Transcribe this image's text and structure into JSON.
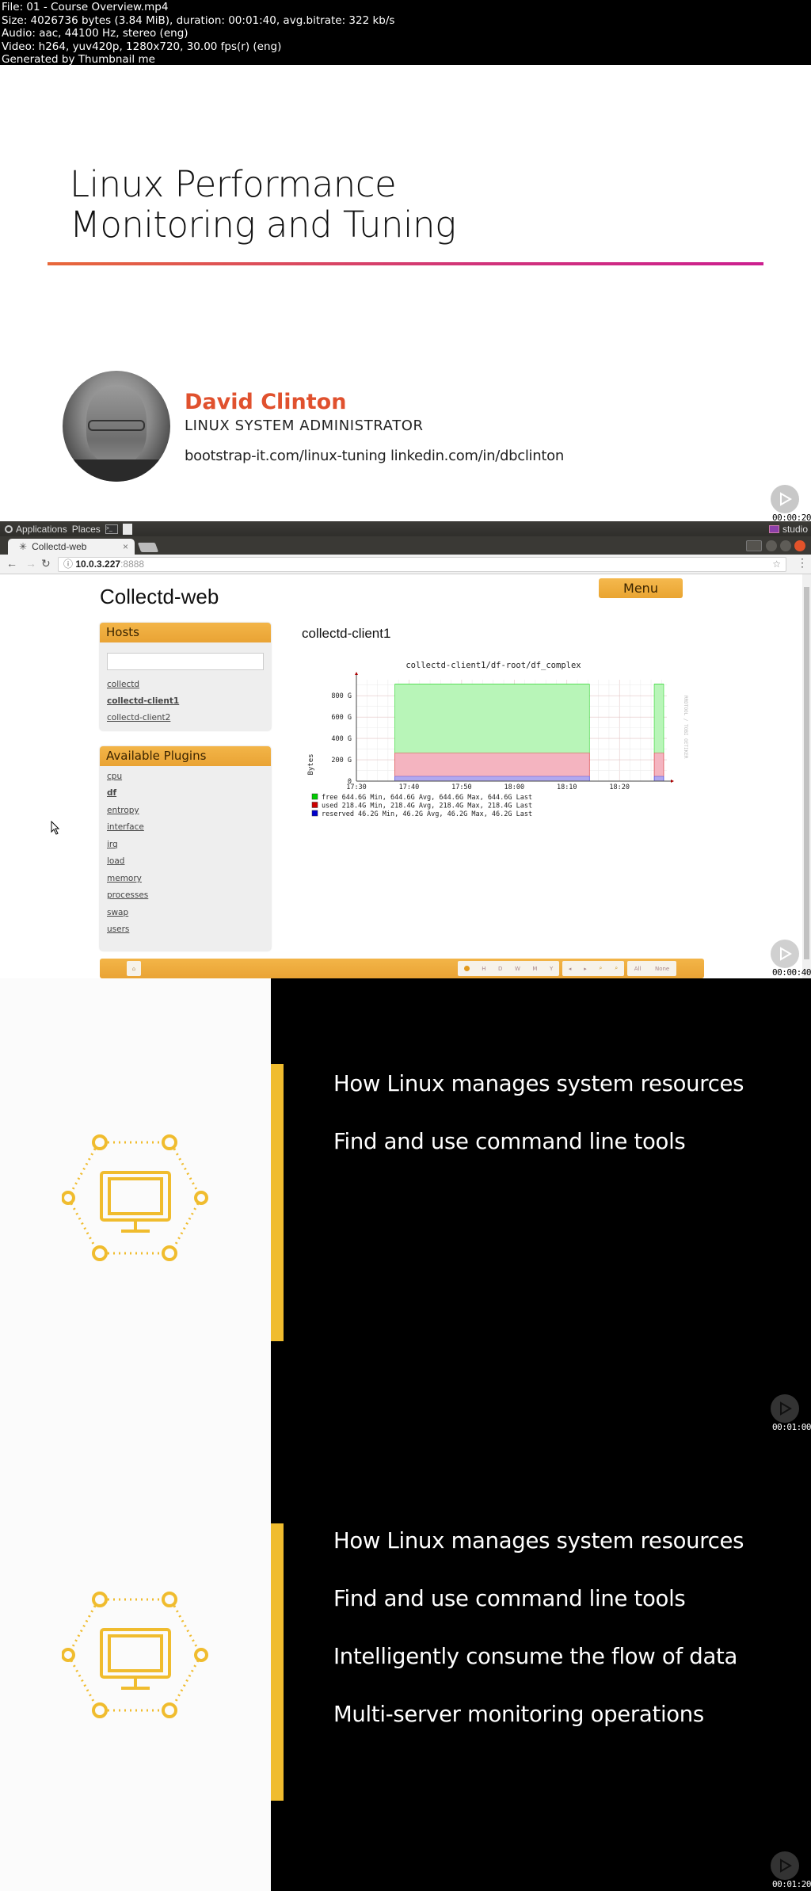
{
  "file_info": [
    "File: 01 - Course Overview.mp4",
    "Size: 4026736 bytes (3.84 MiB), duration: 00:01:40, avg.bitrate: 322 kb/s",
    "Audio: aac, 44100 Hz, stereo (eng)",
    "Video: h264, yuv420p, 1280x720, 30.00 fps(r) (eng)",
    "Generated by Thumbnail me"
  ],
  "slide1": {
    "title_line1": "Linux Performance",
    "title_line2": "Monitoring and Tuning",
    "author_name": "David Clinton",
    "author_role": "LINUX SYSTEM ADMINISTRATOR",
    "author_links": "bootstrap-it.com/linux-tuning linkedin.com/in/dbclinton",
    "timestamp": "00:00:20",
    "accent_color": "#e0512e"
  },
  "desktop": {
    "applications": "Applications",
    "places": "Places",
    "workspace_label": "studio",
    "tab_title": "Collectd-web",
    "tab_close": "×",
    "address_host": "10.0.3.227",
    "address_port": ":8888",
    "timestamp": "00:00:40"
  },
  "collectd": {
    "title": "Collectd-web",
    "menu_label": "Menu",
    "hosts_header": "Hosts",
    "hosts_search_value": "",
    "hosts": [
      "collectd",
      "collectd-client1",
      "collectd-client2"
    ],
    "selected_host": "collectd-client1",
    "plugins_header": "Available Plugins",
    "plugins": [
      "cpu",
      "df",
      "entropy",
      "interface",
      "irq",
      "load",
      "memory",
      "processes",
      "swap",
      "users"
    ],
    "selected_plugin": "df",
    "client_title": "collectd-client1",
    "footer": {
      "time_buttons": [
        "H",
        "D",
        "W",
        "M",
        "Y"
      ],
      "nav_buttons": [
        "◂",
        "▸",
        "zoom-in",
        "zoom-out"
      ],
      "all_label": "All",
      "none_label": "None"
    }
  },
  "chart_data": {
    "type": "area",
    "title": "collectd-client1/df-root/df_complex",
    "ylabel": "Bytes",
    "xlabel": "",
    "watermark": "RRDTOOL / TOBI OETIKER",
    "x_ticks": [
      "17:30",
      "17:40",
      "17:50",
      "18:00",
      "18:10",
      "18:20"
    ],
    "y_ticks": [
      "0",
      "200 G",
      "400 G",
      "600 G",
      "800 G"
    ],
    "ylim": [
      0,
      950
    ],
    "xlim_minutes": [
      0,
      59
    ],
    "stacked": true,
    "segments_minutes": [
      [
        7.3,
        44.3
      ],
      [
        56.6,
        58.4
      ]
    ],
    "series": [
      {
        "name": "reserved",
        "color": "#0000cc",
        "fill": "#b0a8f0",
        "value_g": 46.2,
        "min": "46.2G",
        "avg": "46.2G",
        "max": "46.2G",
        "last": "46.2G"
      },
      {
        "name": "used",
        "color": "#cc0000",
        "fill": "#f4b4c0",
        "value_g": 218.4,
        "min": "218.4G",
        "avg": "218.4G",
        "max": "218.4G",
        "last": "218.4G"
      },
      {
        "name": "free",
        "color": "#00cc00",
        "fill": "#b8f5b8",
        "value_g": 644.6,
        "min": "644.6G",
        "avg": "644.6G",
        "max": "644.6G",
        "last": "644.6G"
      }
    ],
    "legend_labels": {
      "min": "Min,",
      "avg": "Avg,",
      "max": "Max,",
      "last": "Last"
    },
    "grid": true,
    "legend_position": "bottom-left"
  },
  "slide2": {
    "bullets": [
      "How Linux manages system resources",
      "Find and use command line tools"
    ],
    "timestamp": "00:01:00"
  },
  "slide3": {
    "bullets": [
      "How Linux manages system resources",
      "Find and use command line tools",
      "Intelligently consume the flow of data",
      "Multi-server monitoring operations"
    ],
    "timestamp": "00:01:20"
  },
  "brand_yellow": "#f0bc2e"
}
